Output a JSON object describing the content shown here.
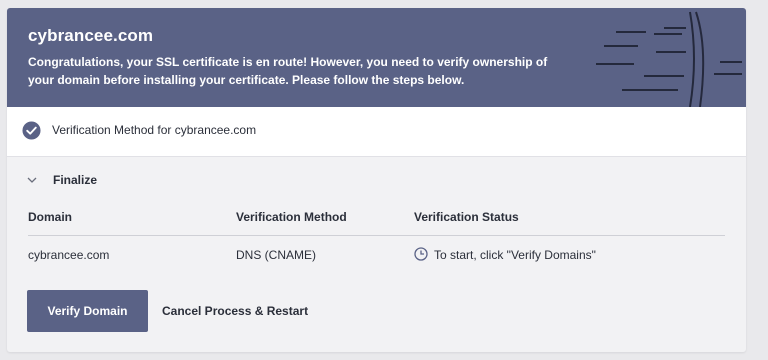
{
  "banner": {
    "title": "cybrancee.com",
    "message": "Congratulations, your SSL certificate is en route! However, you need to verify ownership of your domain before installing your certificate. Please follow the steps below."
  },
  "verification_method": {
    "label": "Verification Method for cybrancee.com",
    "icon": "check-circle-icon"
  },
  "finalize": {
    "label": "Finalize",
    "icon": "chevron-down-icon"
  },
  "table": {
    "headers": [
      "Domain",
      "Verification Method",
      "Verification Status"
    ],
    "rows": [
      {
        "domain": "cybrancee.com",
        "method": "DNS (CNAME)",
        "status_icon": "clock-icon",
        "status": "To start, click \"Verify Domains\""
      }
    ]
  },
  "actions": {
    "verify_label": "Verify Domain",
    "cancel_label": "Cancel Process & Restart"
  },
  "colors": {
    "accent": "#5a6286",
    "banner_text": "#ffffff",
    "background": "#f2f2f4"
  }
}
